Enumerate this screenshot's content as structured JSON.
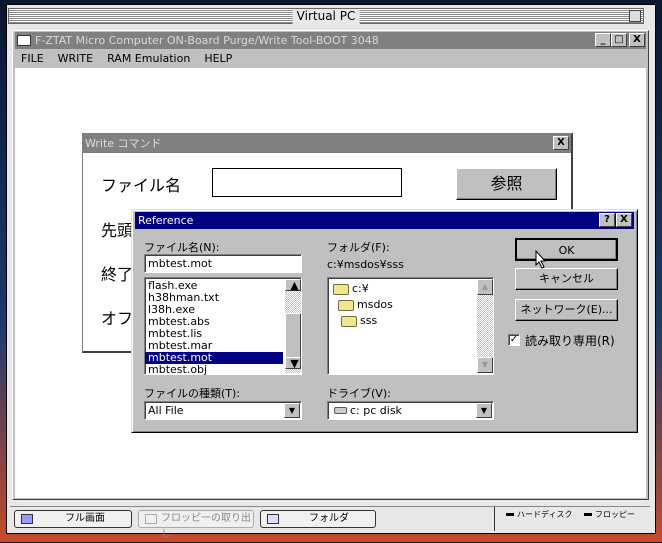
{
  "host_window": {
    "title": "Virtual PC"
  },
  "app": {
    "title": "F-ZTAT Micro Computer ON-Board Purge/Write Tool-BOOT 3048",
    "menu": [
      {
        "label": "FILE",
        "key": "F"
      },
      {
        "label": "WRITE",
        "key": "W"
      },
      {
        "label": "RAM Emulation",
        "key": "R"
      },
      {
        "label": "HELP",
        "key": "H"
      }
    ],
    "controls": {
      "minimize": "_",
      "maximize": "□",
      "close": "X"
    }
  },
  "write_dialog": {
    "title": "Write コマンド",
    "close": "X",
    "file_label": "ファイル名",
    "file_value": "",
    "browse_button": "参照",
    "labels": [
      "先頭",
      "終了",
      "オフ"
    ]
  },
  "reference_dialog": {
    "title": "Reference",
    "help": "?",
    "close": "X",
    "filename_label": "ファイル名(N):",
    "filename_value": "mbtest.mot",
    "files": [
      "flash.exe",
      "h38hman.txt",
      "l38h.exe",
      "mbtest.abs",
      "mbtest.lis",
      "mbtest.mar",
      "mbtest.mot",
      "mbtest.obj"
    ],
    "selected_file": "mbtest.mot",
    "folder_label": "フォルダ(F):",
    "folder_path": "c:¥msdos¥sss",
    "folders": [
      "c:¥",
      "msdos",
      "sss"
    ],
    "filetype_label": "ファイルの種類(T):",
    "filetype_value": "All File",
    "drive_label": "ドライブ(V):",
    "drive_value": "c: pc disk",
    "ok": "OK",
    "cancel": "キャンセル",
    "network": "ネットワーク(E)...",
    "readonly_label": "読み取り専用(R)",
    "readonly_checked": true
  },
  "taskbar": {
    "fullscreen": "フル画面",
    "eject_floppy": "フロッピーの取り出し",
    "folder": "フォルダ",
    "hdd_indicator": "ハードディスク",
    "floppy_indicator": "フロッピー"
  }
}
